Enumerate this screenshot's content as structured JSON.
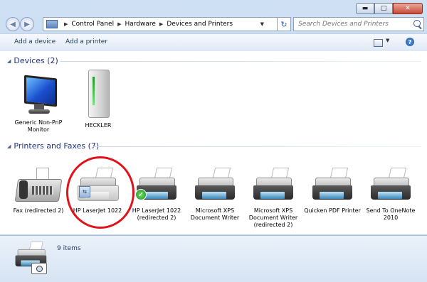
{
  "window": {
    "caption_buttons": {
      "minimize": "▬",
      "maximize": "□",
      "close": "✕"
    }
  },
  "address": {
    "crumbs": [
      "Control Panel",
      "Hardware",
      "Devices and Printers"
    ],
    "search_placeholder": "Search Devices and Printers"
  },
  "toolbar": {
    "add_device": "Add a device",
    "add_printer": "Add a printer",
    "help": "?"
  },
  "groups": {
    "devices": {
      "title": "Devices (2)",
      "items": [
        {
          "label": "Generic Non-PnP Monitor",
          "icon": "monitor-icon"
        },
        {
          "label": "HECKLER",
          "icon": "computer-tower-icon"
        }
      ]
    },
    "printers": {
      "title": "Printers and Faxes (7)",
      "items": [
        {
          "label": "Fax (redirected 2)",
          "icon": "fax-icon"
        },
        {
          "label": "HP LaserJet 1022",
          "icon": "printer-icon",
          "badge": "share-icon"
        },
        {
          "label": "HP LaserJet 1022 (redirected 2)",
          "icon": "printer-icon",
          "badge": "default-check-icon"
        },
        {
          "label": "Microsoft XPS Document Writer",
          "icon": "printer-icon"
        },
        {
          "label": "Microsoft XPS Document Writer (redirected 2)",
          "icon": "printer-icon"
        },
        {
          "label": "Quicken PDF Printer",
          "icon": "printer-icon"
        },
        {
          "label": "Send To OneNote 2010",
          "icon": "printer-icon"
        }
      ]
    }
  },
  "details": {
    "count": "9 items"
  },
  "colors": {
    "highlight_circle": "#e0131a",
    "group_header": "#1e3287"
  }
}
